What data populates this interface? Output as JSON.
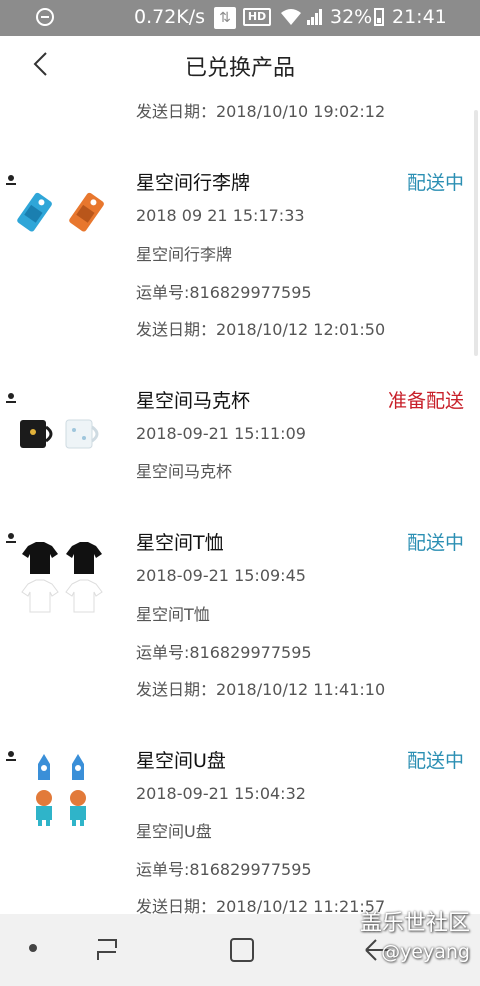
{
  "status_bar": {
    "net_speed": "0.72K/s",
    "hd_badge": "HD",
    "battery": "32%",
    "time": "21:41"
  },
  "header": {
    "title": "已兑换产品"
  },
  "partial_top": {
    "ship_date": "发送日期：2018/10/10 19:02:12"
  },
  "items": [
    {
      "name": "星空间行李牌",
      "status": "配送中",
      "date": "2018 09 21 15:17:33",
      "desc": "星空间行李牌",
      "tracking": "运单号:816829977595",
      "ship_date": "发送日期：2018/10/12 12:01:50"
    },
    {
      "name": "星空间马克杯",
      "status": "准备配送",
      "date": "2018-09-21 15:11:09",
      "desc": "星空间马克杯"
    },
    {
      "name": "星空间T恤",
      "status": "配送中",
      "date": "2018-09-21 15:09:45",
      "desc": "星空间T恤",
      "tracking": "运单号:816829977595",
      "ship_date": "发送日期：2018/10/12 11:41:10"
    },
    {
      "name": "星空间U盘",
      "status": "配送中",
      "date": "2018-09-21 15:04:32",
      "desc": "星空间U盘",
      "tracking": "运单号:816829977595",
      "ship_date": "发送日期：2018/10/12 11:21:57"
    }
  ],
  "watermark": {
    "line1": "盖乐世社区",
    "line2": "@yeyang"
  },
  "colors": {
    "status_shipping": "#2b8fb3",
    "status_preparing": "#c8202a"
  }
}
